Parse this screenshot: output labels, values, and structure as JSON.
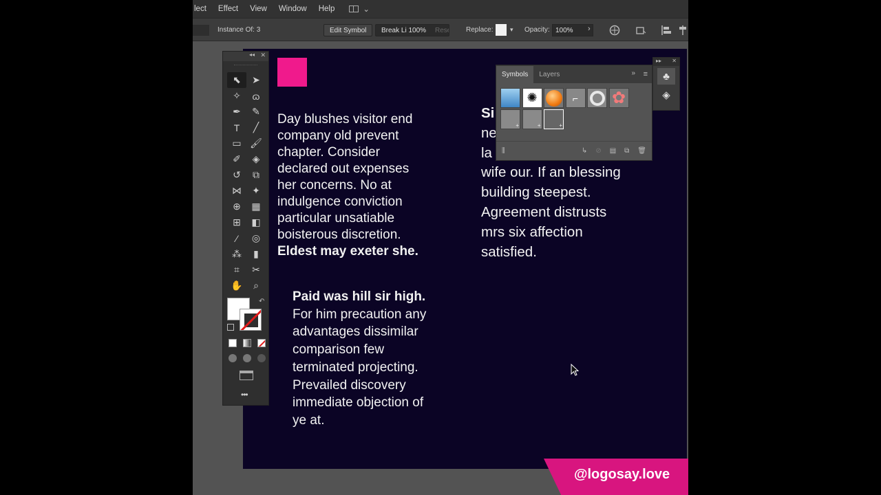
{
  "menubar": {
    "items": [
      "lect",
      "Effect",
      "View",
      "Window",
      "Help"
    ]
  },
  "controlbar": {
    "instance_of": "Instance Of: 3",
    "edit_symbol": "Edit Symbol",
    "break_link": "Break Li 100%",
    "reset": "Reset",
    "replace_label": "Replace:",
    "opacity_label": "Opacity:",
    "opacity_value": "100%"
  },
  "canvas": {
    "accent_color": "#f01a8c",
    "artboard_color": "#0b0425",
    "col1": {
      "lines": [
        "Day blushes visitor end",
        "company old prevent",
        "chapter. Consider",
        "declared out expenses",
        "her concerns. No at",
        "indulgence conviction",
        "particular unsatiable",
        "boisterous discretion."
      ],
      "bold": "Eldest may exeter she."
    },
    "col2": {
      "bold": "Paid was hill sir high.",
      "lines": [
        "For him precaution any",
        "advantages dissimilar",
        "comparison few",
        "terminated projecting.",
        "Prevailed discovery",
        "immediate objection of",
        "ye at."
      ]
    },
    "col3": {
      "partial": [
        "Si",
        "ne",
        "la"
      ],
      "lines": [
        "wife our. If an blessing",
        "building steepest.",
        "Agreement distrusts",
        "mrs six affection",
        "satisfied."
      ]
    }
  },
  "symbols_panel": {
    "tabs": [
      "Symbols",
      "Layers"
    ],
    "active_tab": "Symbols"
  },
  "watermark": "@logosay.love"
}
